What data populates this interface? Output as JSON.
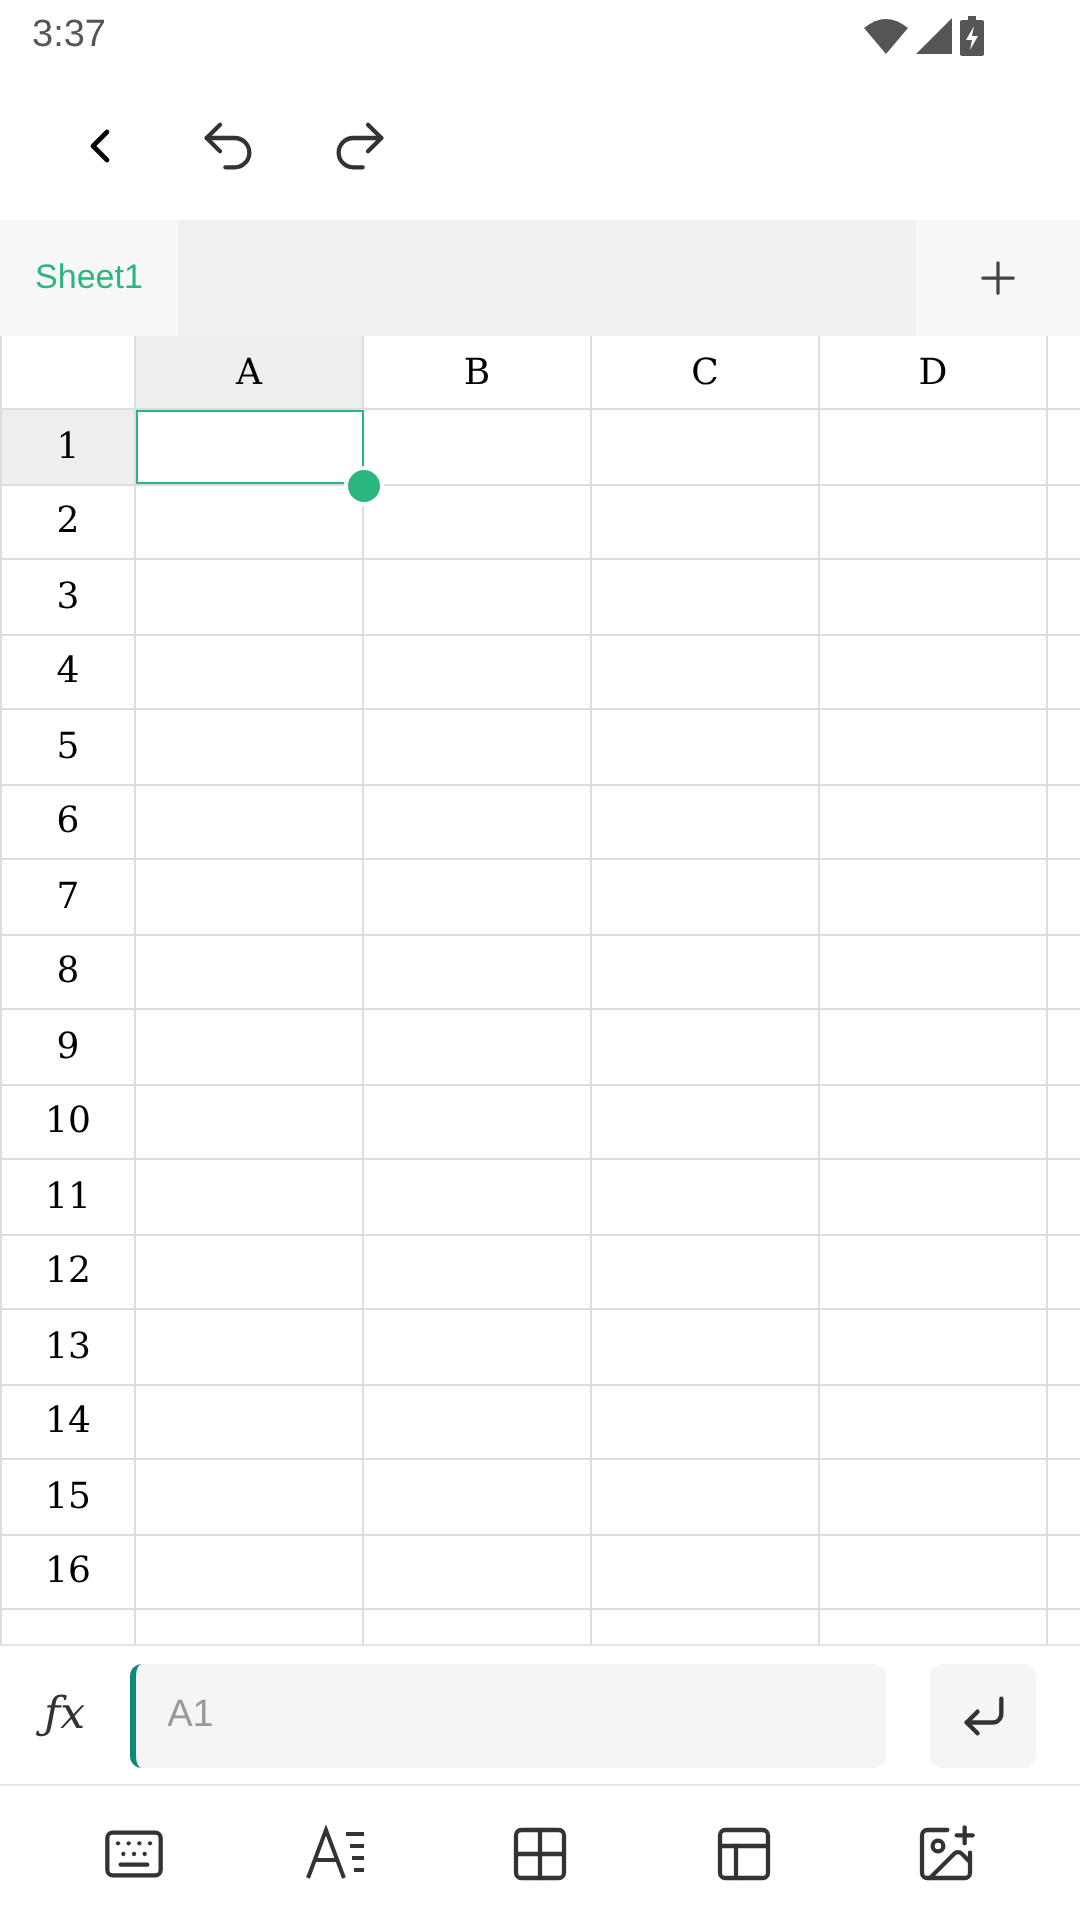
{
  "status_bar": {
    "time": "3:37"
  },
  "sheet_tabs": [
    {
      "label": "Sheet1",
      "selected": true
    }
  ],
  "grid": {
    "columns": [
      {
        "label": "A",
        "selected": true
      },
      {
        "label": "B",
        "selected": false
      },
      {
        "label": "C",
        "selected": false
      },
      {
        "label": "D",
        "selected": false
      }
    ],
    "rows": [
      {
        "label": "1",
        "selected": true
      },
      {
        "label": "2",
        "selected": false
      },
      {
        "label": "3",
        "selected": false
      },
      {
        "label": "4",
        "selected": false
      },
      {
        "label": "5",
        "selected": false
      },
      {
        "label": "6",
        "selected": false
      },
      {
        "label": "7",
        "selected": false
      },
      {
        "label": "8",
        "selected": false
      },
      {
        "label": "9",
        "selected": false
      },
      {
        "label": "10",
        "selected": false
      },
      {
        "label": "11",
        "selected": false
      },
      {
        "label": "12",
        "selected": false
      },
      {
        "label": "13",
        "selected": false
      },
      {
        "label": "14",
        "selected": false
      },
      {
        "label": "15",
        "selected": false
      },
      {
        "label": "16",
        "selected": false
      }
    ]
  },
  "formula_bar": {
    "function_label": "ƒx",
    "placeholder": "A1"
  }
}
